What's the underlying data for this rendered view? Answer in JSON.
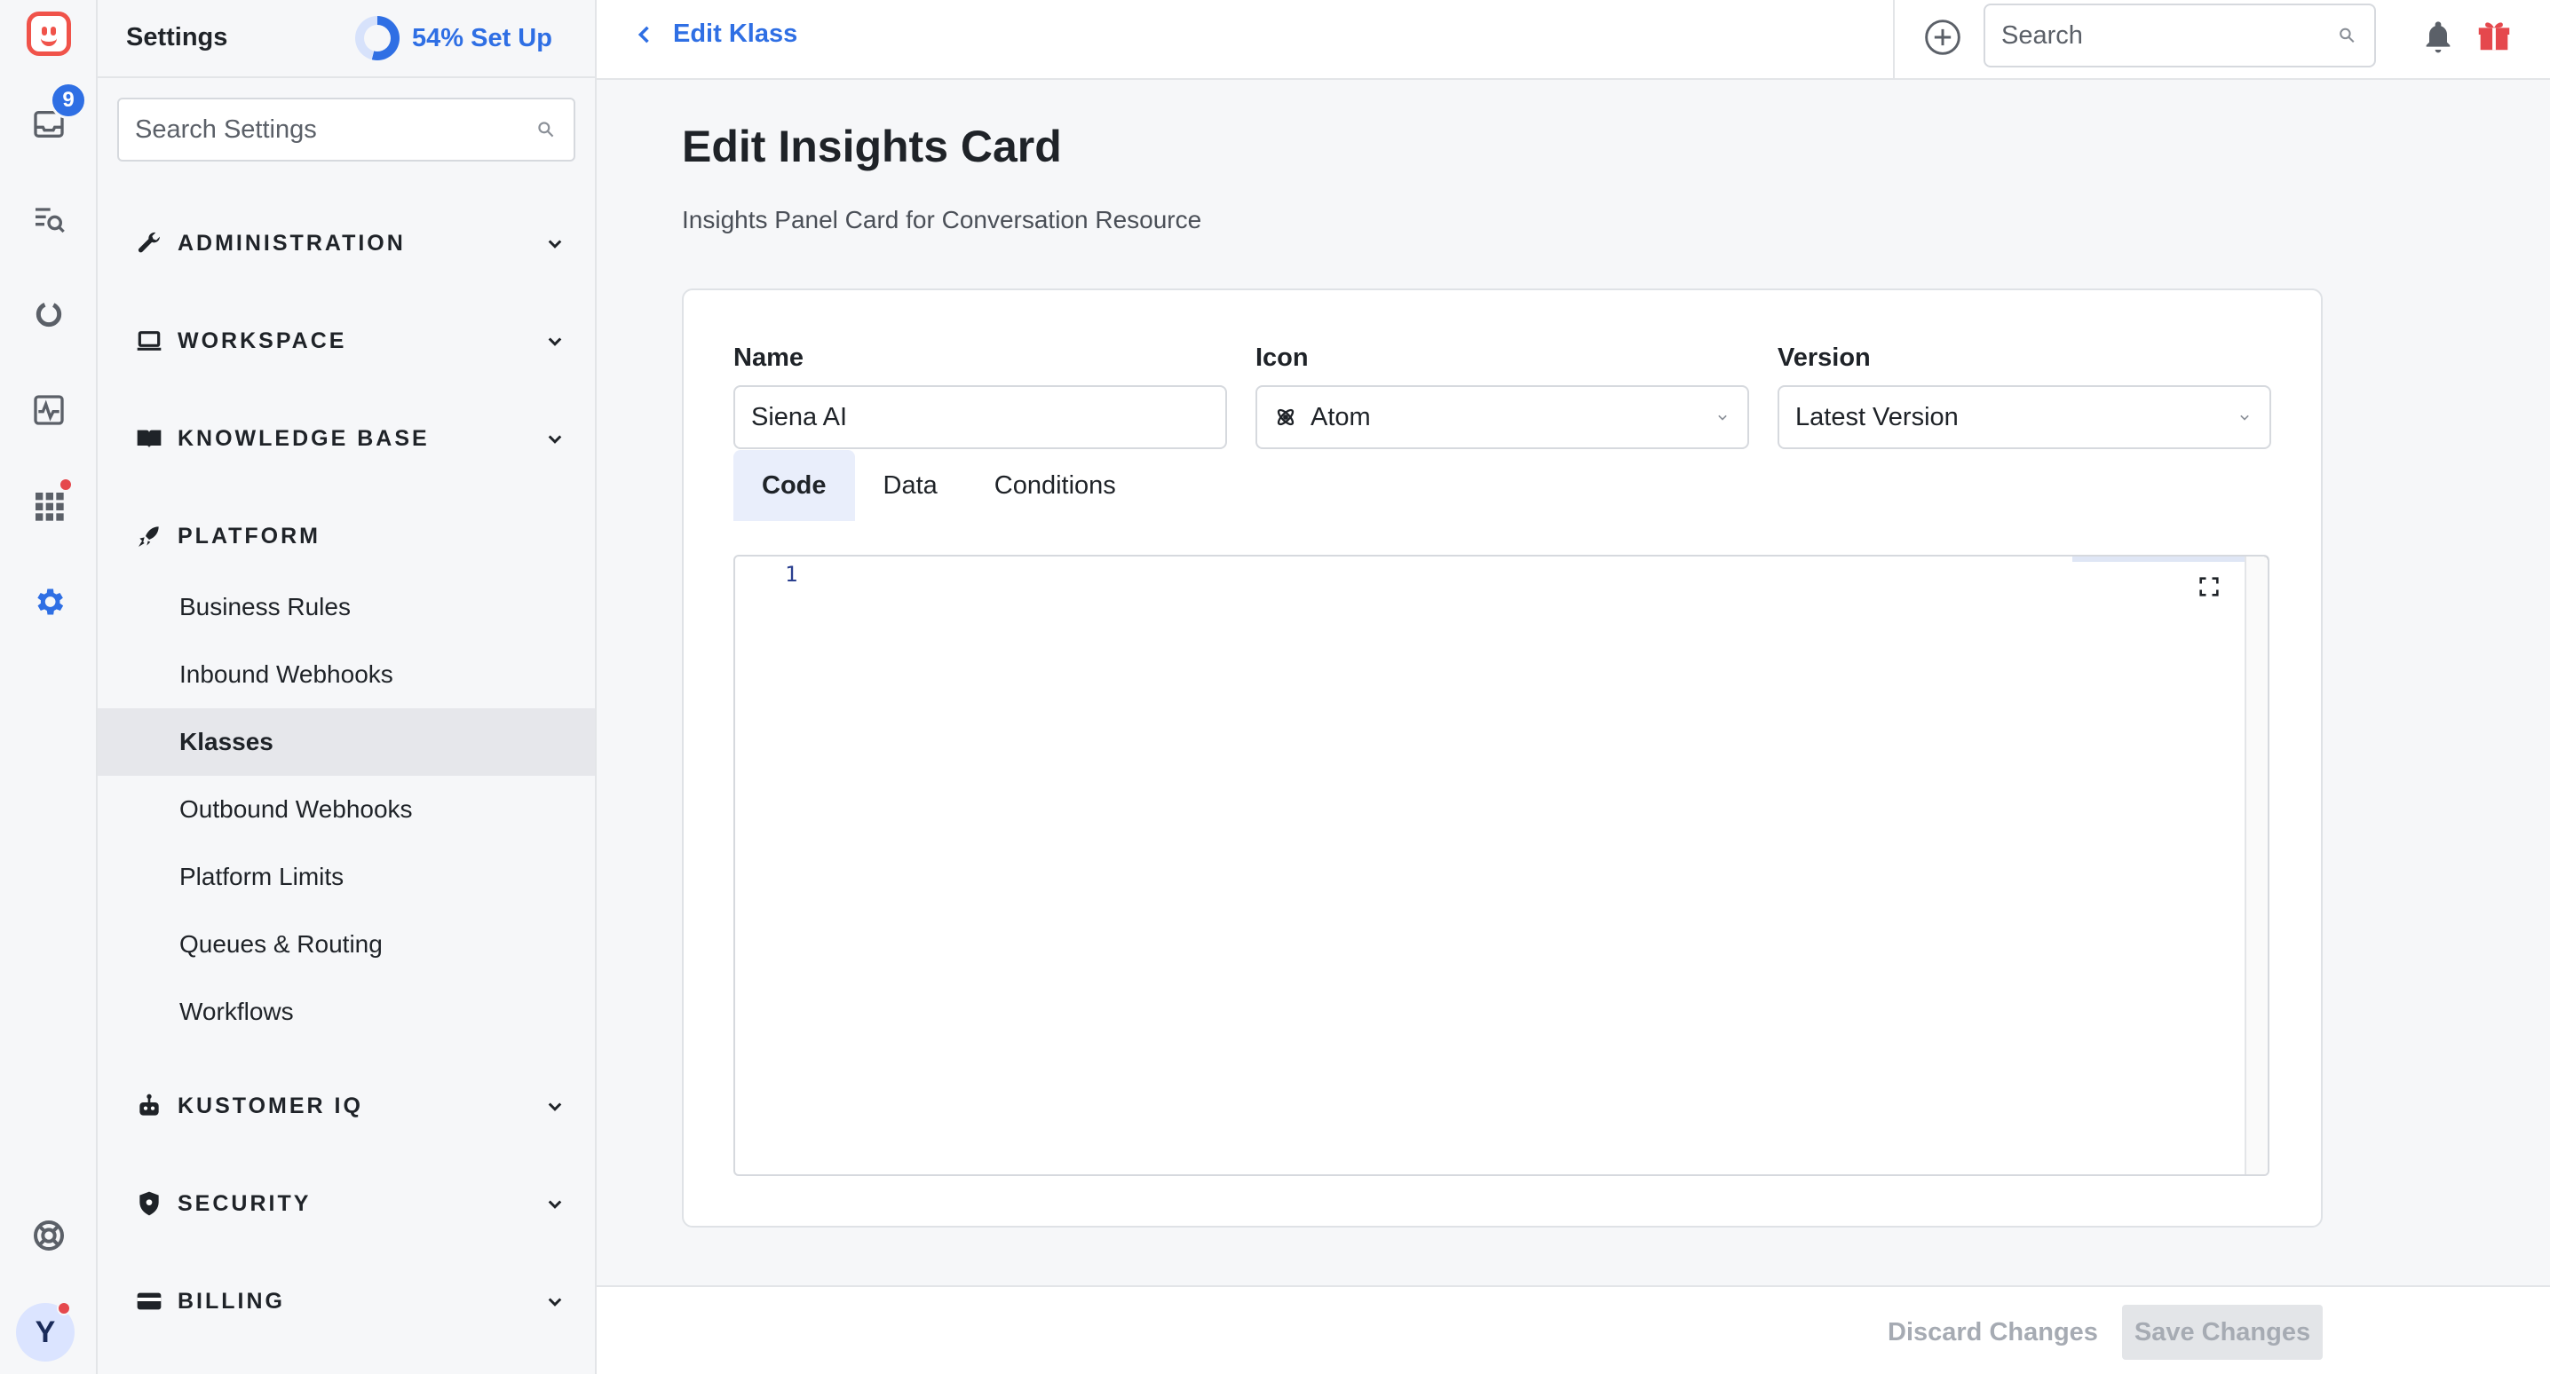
{
  "rail": {
    "logo": "kustomer-logo",
    "inbox_badge": "9",
    "avatar_initial": "Y",
    "accent": "#2f6fe4",
    "notification_dot_color": "#e5484d"
  },
  "settings": {
    "title": "Settings",
    "setup_progress_percent": 54,
    "setup_label": "54% Set Up",
    "search_placeholder": "Search Settings",
    "sections": [
      {
        "label": "ADMINISTRATION",
        "icon": "wrench-icon",
        "expanded": false
      },
      {
        "label": "WORKSPACE",
        "icon": "laptop-icon",
        "expanded": false
      },
      {
        "label": "KNOWLEDGE BASE",
        "icon": "book-icon",
        "expanded": false
      },
      {
        "label": "PLATFORM",
        "icon": "rocket-icon",
        "expanded": true
      },
      {
        "label": "KUSTOMER IQ",
        "icon": "robot-icon",
        "expanded": false
      },
      {
        "label": "SECURITY",
        "icon": "shield-icon",
        "expanded": false
      },
      {
        "label": "BILLING",
        "icon": "credit-card-icon",
        "expanded": false
      }
    ],
    "platform_items": [
      {
        "label": "Business Rules",
        "active": false
      },
      {
        "label": "Inbound Webhooks",
        "active": false
      },
      {
        "label": "Klasses",
        "active": true
      },
      {
        "label": "Outbound Webhooks",
        "active": false
      },
      {
        "label": "Platform Limits",
        "active": false
      },
      {
        "label": "Queues & Routing",
        "active": false
      },
      {
        "label": "Workflows",
        "active": false
      }
    ]
  },
  "topbar": {
    "back_label": "Edit Klass",
    "search_placeholder": "Search"
  },
  "main": {
    "title": "Edit Insights Card",
    "subtitle": "Insights Panel Card for Conversation Resource",
    "name_label": "Name",
    "name_value": "Siena AI",
    "icon_label": "Icon",
    "icon_value": "Atom",
    "version_label": "Version",
    "version_value": "Latest Version",
    "tabs": [
      {
        "label": "Code",
        "active": true
      },
      {
        "label": "Data",
        "active": false
      },
      {
        "label": "Conditions",
        "active": false
      }
    ],
    "editor": {
      "line_numbers": [
        "1"
      ]
    }
  },
  "footer": {
    "discard_label": "Discard Changes",
    "save_label": "Save Changes"
  }
}
